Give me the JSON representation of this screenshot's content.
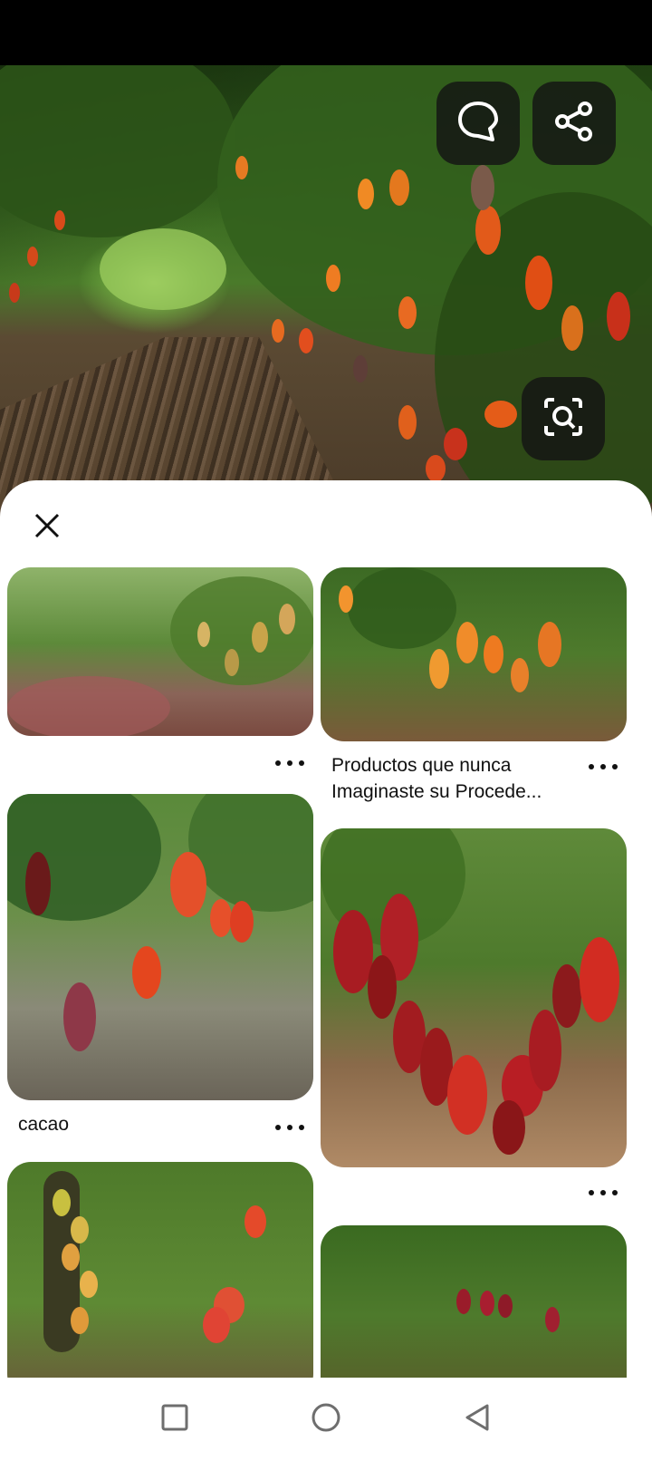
{
  "hero": {
    "description_icon": "comment-icon",
    "share_icon": "share-icon",
    "visual_search_icon": "lens-icon"
  },
  "sheet": {
    "close_icon": "close-icon",
    "pins": [
      {
        "title": ""
      },
      {
        "title": "Productos que nunca Imaginaste su Procede..."
      },
      {
        "title": "cacao"
      },
      {
        "title": ""
      },
      {
        "title": ""
      },
      {
        "title": ""
      }
    ]
  },
  "navbar": {
    "recents_icon": "square-icon",
    "home_icon": "circle-icon",
    "back_icon": "triangle-back-icon"
  },
  "colors": {
    "background": "#ffffff",
    "overlay_button": "#141414",
    "text": "#111111"
  }
}
